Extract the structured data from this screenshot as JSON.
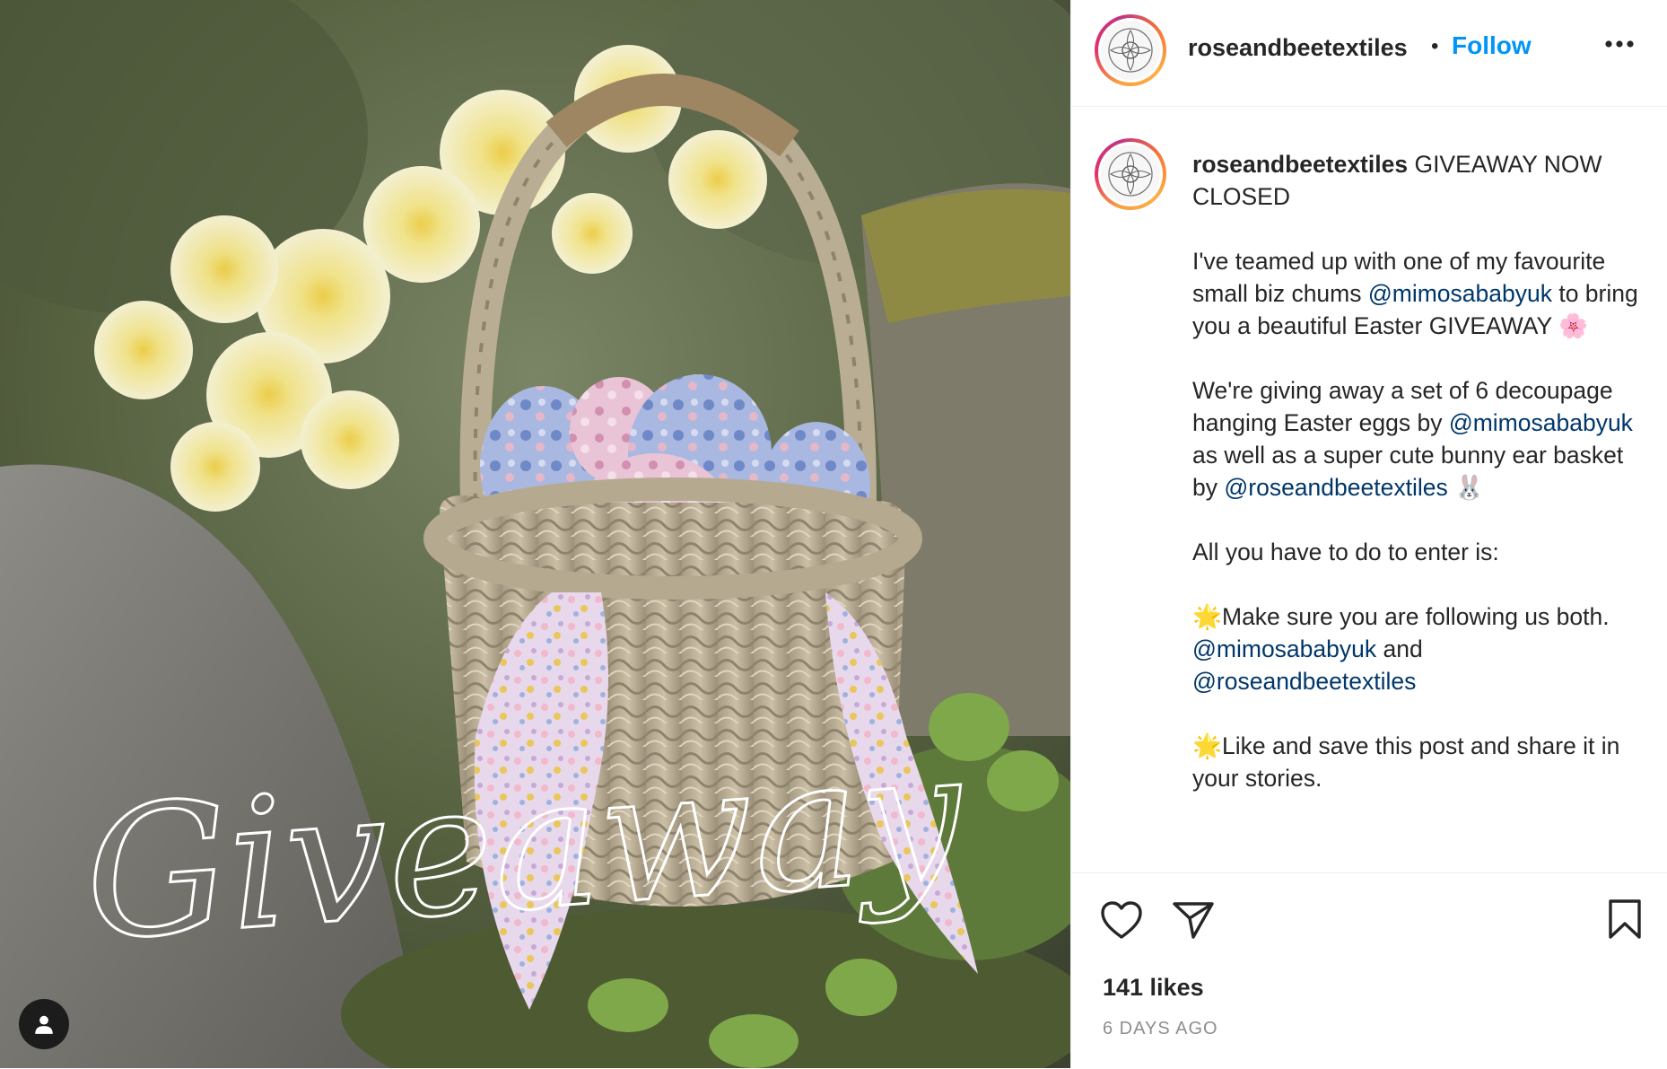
{
  "post": {
    "photo_alt": "",
    "photo_overlay_text": "Giveaway"
  },
  "header": {
    "username": "roseandbeetextiles",
    "separator": "•",
    "follow_label": "Follow",
    "more_icon": "more-horizontal-icon"
  },
  "caption": {
    "username": "roseandbeetextiles",
    "lines": [
      {
        "parts": [
          {
            "t": "text",
            "v": " GIVEAWAY NOW CLOSED"
          }
        ]
      },
      {
        "parts": [
          {
            "t": "text",
            "v": "I've teamed up with one of my favourite small biz chums "
          },
          {
            "t": "mention",
            "v": "@mimosababyuk"
          },
          {
            "t": "text",
            "v": " to bring you a beautiful Easter GIVEAWAY 🌸"
          }
        ]
      },
      {
        "parts": [
          {
            "t": "text",
            "v": "We're giving away a set of 6 decoupage hanging Easter eggs by "
          },
          {
            "t": "mention",
            "v": "@mimosababyuk"
          },
          {
            "t": "text",
            "v": " as well as a super cute bunny ear basket by "
          },
          {
            "t": "mention",
            "v": "@roseandbeetextiles"
          },
          {
            "t": "text",
            "v": " 🐰"
          }
        ]
      },
      {
        "parts": [
          {
            "t": "text",
            "v": "All you have to do to enter is:"
          }
        ]
      },
      {
        "parts": [
          {
            "t": "text",
            "v": "🌟Make sure you are following us both. "
          },
          {
            "t": "mention",
            "v": "@mimosababyuk"
          },
          {
            "t": "text",
            "v": " and "
          },
          {
            "t": "mention",
            "v": "@roseandbeetextiles"
          }
        ]
      },
      {
        "parts": [
          {
            "t": "text",
            "v": "🌟Like and save this post and share it in your stories."
          }
        ]
      }
    ]
  },
  "actions": {
    "like_icon": "heart-icon",
    "share_icon": "paper-plane-icon",
    "save_icon": "bookmark-icon",
    "likes": "141 likes",
    "time_ago": "6 DAYS AGO"
  },
  "tag_icon": "user-tag-icon",
  "colors": {
    "follow": "#0095f6",
    "mention": "#00376b",
    "text": "#262626",
    "muted": "#8e8e8e"
  }
}
